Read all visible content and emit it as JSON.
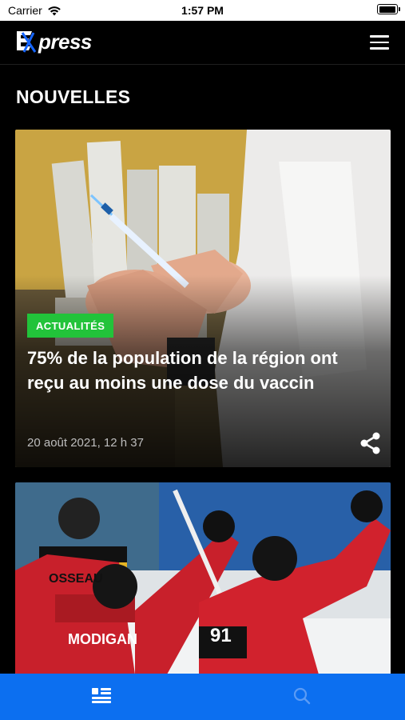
{
  "status_bar": {
    "carrier": "Carrier",
    "time": "1:57 PM",
    "icons": [
      "wifi-icon",
      "battery-icon"
    ]
  },
  "header": {
    "logo_text": "press",
    "logo_name": "Express",
    "menu_icon": "hamburger-menu-icon"
  },
  "section": {
    "title": "NOUVELLES"
  },
  "articles": [
    {
      "category": "ACTUALITÉS",
      "headline": "75% de la population de la région ont reçu au moins une dose du vaccin",
      "date": "20 août 2021, 12 h 37",
      "photo": "vaccine-syringe-photo",
      "share_icon": "share-icon"
    },
    {
      "photo": "hockey-players-celebration-photo",
      "jersey_names": [
        "OSSEAU",
        "MODIGAN"
      ],
      "jersey_number": "91"
    }
  ],
  "tab_bar": {
    "tabs": [
      {
        "icon": "news-list-icon",
        "active": true
      },
      {
        "icon": "search-icon",
        "active": false
      }
    ]
  },
  "colors": {
    "background": "#000000",
    "badge": "#22c33a",
    "tab_bar": "#0c6ff0"
  }
}
